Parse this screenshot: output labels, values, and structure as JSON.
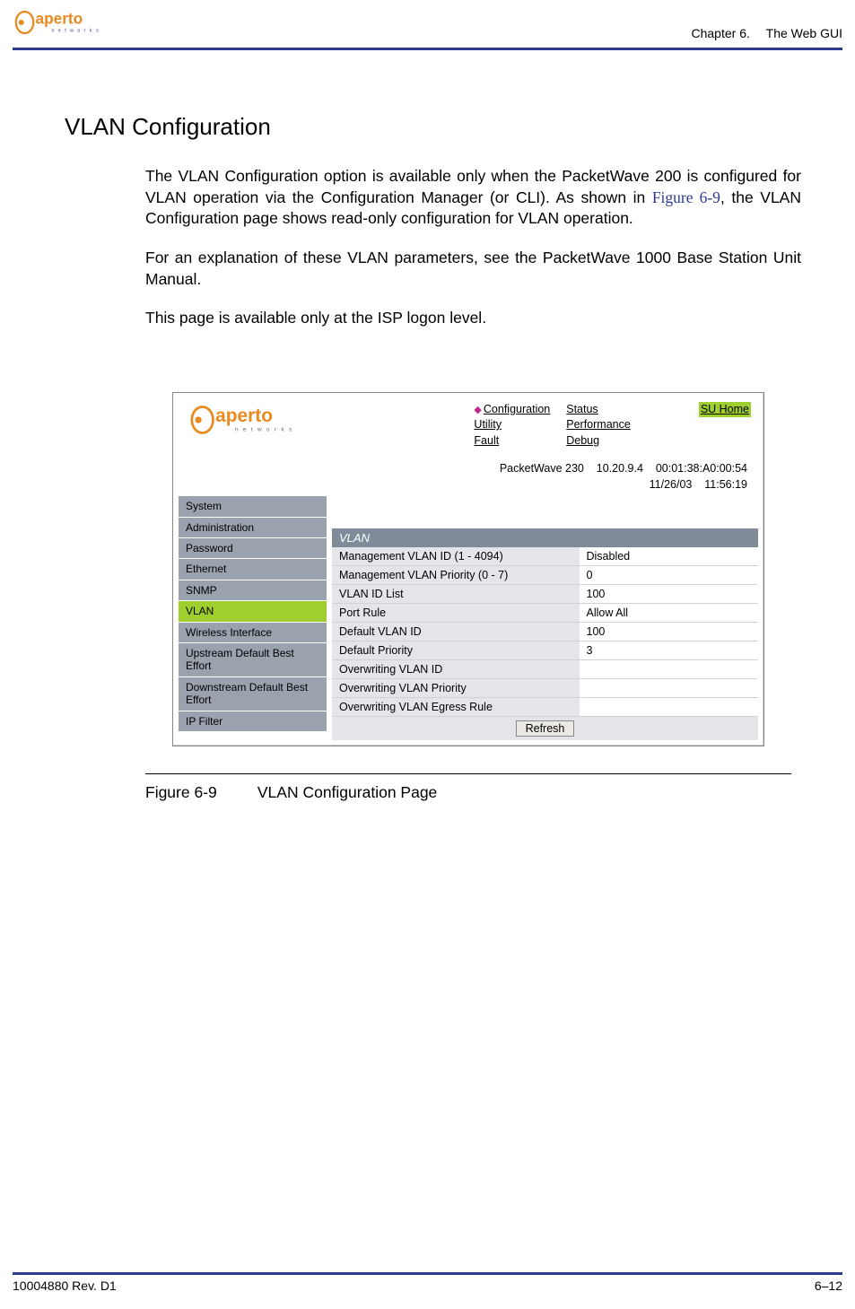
{
  "header": {
    "chapter": "Chapter 6.",
    "chapter_title": "The Web GUI"
  },
  "section": {
    "title": "VLAN Configuration",
    "p1a": "The VLAN Configuration option is available only when the PacketWave 200 is configured for VLAN operation via the Configuration Manager (or CLI). As shown in ",
    "p1_ref": "Figure 6-9",
    "p1b": ", the VLAN Configuration page shows read-only configuration for VLAN operation.",
    "p2": "For an explanation of these VLAN parameters, see the PacketWave 1000 Base Station Unit Manual.",
    "p3": "This page is available only at the ISP logon level."
  },
  "gui": {
    "nav_col1": [
      "Configuration",
      "Utility",
      "Fault"
    ],
    "nav_col2": [
      "Status",
      "Performance",
      "Debug"
    ],
    "su_home": "SU Home",
    "status": {
      "device": "PacketWave 230",
      "ip": "10.20.9.4",
      "mac": "00:01:38:A0:00:54",
      "date": "11/26/03",
      "time": "11:56:19"
    },
    "sidebar": [
      {
        "label": "System",
        "active": false
      },
      {
        "label": "Administration",
        "active": false
      },
      {
        "label": "Password",
        "active": false
      },
      {
        "label": "Ethernet",
        "active": false
      },
      {
        "label": "SNMP",
        "active": false
      },
      {
        "label": "VLAN",
        "active": true
      },
      {
        "label": "Wireless Interface",
        "active": false
      },
      {
        "label": "Upstream Default Best Effort",
        "active": false
      },
      {
        "label": "Downstream Default Best Effort",
        "active": false
      },
      {
        "label": "IP Filter",
        "active": false
      }
    ],
    "vlan_header": "VLAN",
    "rows": [
      {
        "label": "Management VLAN ID (1 - 4094)",
        "value": "Disabled"
      },
      {
        "label": "Management VLAN Priority (0 - 7)",
        "value": "0"
      },
      {
        "label": "VLAN ID List",
        "value": "100"
      },
      {
        "label": "Port Rule",
        "value": "Allow All"
      },
      {
        "label": "Default VLAN ID",
        "value": "100"
      },
      {
        "label": "Default Priority",
        "value": "3"
      },
      {
        "label": "Overwriting VLAN ID",
        "value": ""
      },
      {
        "label": "Overwriting VLAN Priority",
        "value": ""
      },
      {
        "label": "Overwriting VLAN Egress Rule",
        "value": ""
      }
    ],
    "refresh": "Refresh"
  },
  "figure": {
    "num": "Figure 6-9",
    "caption": "VLAN Configuration Page"
  },
  "footer": {
    "doc_id": "10004880 Rev. D1",
    "page": "6–12"
  }
}
